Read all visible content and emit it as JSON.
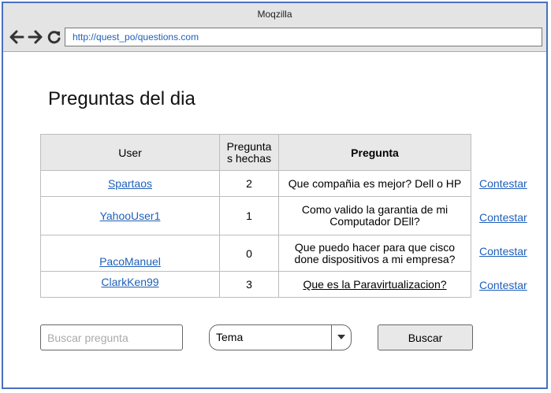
{
  "browser": {
    "title": "Moqzilla",
    "url": "http://quest_po/questions.com",
    "back_icon": "arrow-left-icon",
    "forward_icon": "arrow-right-icon",
    "reload_icon": "reload-icon"
  },
  "page": {
    "title": "Preguntas del dia"
  },
  "table": {
    "headers": {
      "user": "User",
      "count": "Pregunta\ns hechas",
      "question": "Pregunta"
    },
    "rows": [
      {
        "user": "Spartaos",
        "count": "2",
        "question": "Que compañia es mejor? Dell o HP",
        "action": "Contestar"
      },
      {
        "user": "YahooUser1",
        "count": "1",
        "question": "Como valido la garantia de mi Computador DEll?",
        "action": "Contestar"
      },
      {
        "user": "PacoManuel",
        "count": "0",
        "question": "Que puedo hacer para que cisco done dispositivos a mi empresa?",
        "action": "Contestar"
      },
      {
        "user": "ClarkKen99",
        "count": "3",
        "question": "Que es la Paravirtualizacion?",
        "action": "Contestar"
      }
    ]
  },
  "search": {
    "placeholder": "Buscar pregunta",
    "topic_value": "Tema",
    "button_label": "Buscar"
  },
  "colors": {
    "link": "#1f5fb8",
    "window_border": "#4a6fc0",
    "header_bg": "#e8e8e8"
  }
}
